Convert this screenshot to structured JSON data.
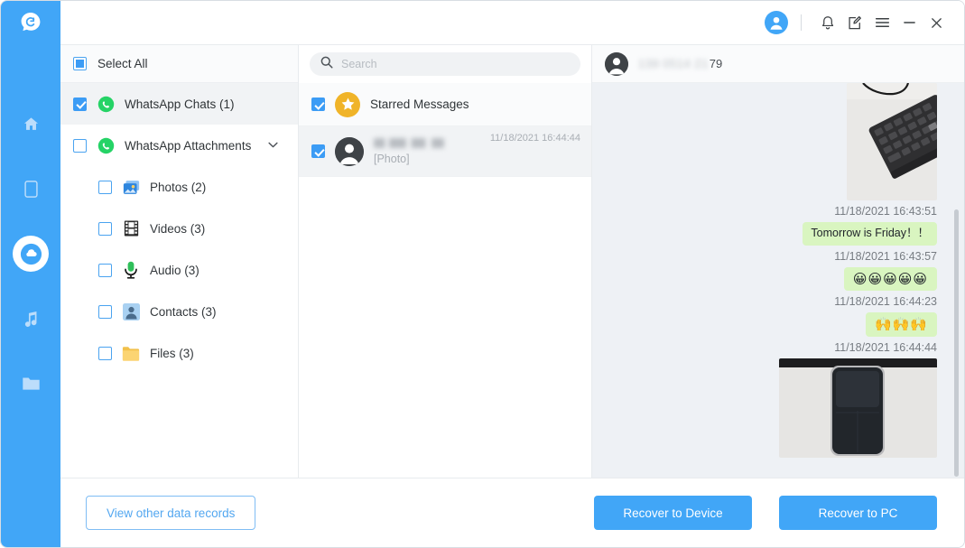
{
  "app": {
    "logo_icon": "chat-bubble-c-logo",
    "accent_color": "#41a6f7",
    "rail_items": [
      {
        "icon": "home-icon",
        "name": "home",
        "active": false
      },
      {
        "icon": "device-icon",
        "name": "device",
        "active": false
      },
      {
        "icon": "cloud-recovery-icon",
        "name": "recovery",
        "active": true
      },
      {
        "icon": "music-icon",
        "name": "music",
        "active": false
      },
      {
        "icon": "folder-icon",
        "name": "files",
        "active": false
      }
    ]
  },
  "titlebar": {
    "avatar_icon": "account-avatar-icon",
    "buttons": [
      {
        "icon": "bell-icon",
        "name": "notifications"
      },
      {
        "icon": "feedback-note-icon",
        "name": "feedback"
      },
      {
        "icon": "hamburger-menu-icon",
        "name": "menu"
      },
      {
        "icon": "minimize-icon",
        "name": "minimize"
      },
      {
        "icon": "close-icon",
        "name": "close"
      }
    ]
  },
  "categories": {
    "select_all_label": "Select All",
    "select_all_state": "indeterminate",
    "items": [
      {
        "label": "WhatsApp Chats (1)",
        "icon": "whatsapp-icon",
        "checked": true,
        "selected": true,
        "sub": false,
        "chevron": false
      },
      {
        "label": "WhatsApp Attachments",
        "icon": "whatsapp-icon",
        "checked": false,
        "selected": false,
        "sub": false,
        "chevron": true
      },
      {
        "label": "Photos (2)",
        "icon": "photos-icon",
        "checked": false,
        "selected": false,
        "sub": true,
        "chevron": false
      },
      {
        "label": "Videos (3)",
        "icon": "videos-icon",
        "checked": false,
        "selected": false,
        "sub": true,
        "chevron": false
      },
      {
        "label": "Audio (3)",
        "icon": "audio-microphone-icon",
        "checked": false,
        "selected": false,
        "sub": true,
        "chevron": false
      },
      {
        "label": "Contacts (3)",
        "icon": "contacts-icon",
        "checked": false,
        "selected": false,
        "sub": true,
        "chevron": false
      },
      {
        "label": "Files (3)",
        "icon": "files-folder-icon",
        "checked": false,
        "selected": false,
        "sub": true,
        "chevron": false
      }
    ]
  },
  "search": {
    "placeholder": "Search",
    "value": "",
    "icon": "search-icon"
  },
  "chat_list": [
    {
      "type": "starred",
      "label": "Starred Messages",
      "icon": "star-icon",
      "checked": true,
      "time": "",
      "snippet": ""
    },
    {
      "type": "conversation",
      "label": "",
      "name_redacted": true,
      "icon": "person-avatar-icon",
      "checked": true,
      "time": "11/18/2021 16:44:44",
      "snippet": "[Photo]",
      "active": true
    }
  ],
  "conversation": {
    "avatar_icon": "person-avatar-icon",
    "phone_redacted": "139 0514 21",
    "phone_visible": "79",
    "messages": [
      {
        "kind": "photo",
        "alt": "keyboard-on-desk-photo",
        "timestamp": "11/18/2021 16:43:51"
      },
      {
        "kind": "text",
        "text": "Tomorrow is Friday！！",
        "timestamp": "11/18/2021 16:43:57"
      },
      {
        "kind": "emoji",
        "text": "😀😀😀😀😀",
        "timestamp": "11/18/2021 16:44:23"
      },
      {
        "kind": "emoji",
        "text": "🙌🙌🙌",
        "timestamp": "11/18/2021 16:44:44"
      },
      {
        "kind": "photo",
        "alt": "smartphone-on-table-photo",
        "timestamp": ""
      }
    ]
  },
  "footer": {
    "view_other_label": "View other data records",
    "recover_device_label": "Recover to Device",
    "recover_pc_label": "Recover to PC"
  }
}
